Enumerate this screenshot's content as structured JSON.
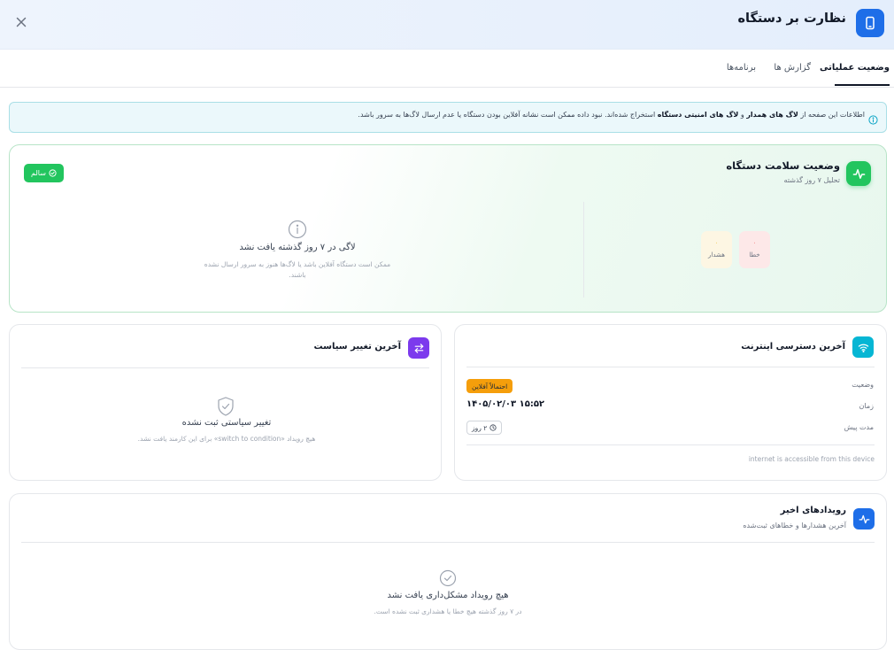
{
  "header": {
    "title": "نظارت بر دستگاه",
    "icon": "smartphone-icon",
    "close_icon": "close-icon"
  },
  "tabs": [
    {
      "label": "وضعیت عملیاتی",
      "active": true
    },
    {
      "label": "گزارش ها",
      "active": false
    },
    {
      "label": "برنامه‌ها",
      "active": false
    }
  ],
  "banner": {
    "part1": "اطلاعات این صفحه از ",
    "bold1": "لاگ های همدار",
    "part2": " و ",
    "bold2": "لاگ های امنیتی دستگاه",
    "part3": " استخراج شده‌اند. نبود داده ممکن است نشانه آفلاین بودن دستگاه یا عدم ارسال لاگ‌ها به سرور باشد.",
    "icon": "info-icon"
  },
  "health": {
    "title": "وضعیت سلامت دستگاه",
    "subtitle": "تحلیل ۷ روز گذشته",
    "status_badge": "سالم",
    "stats": {
      "error_value": "۰",
      "error_label": "خطا",
      "warning_value": "۰",
      "warning_label": "هشدار"
    },
    "empty_title": "لاگی در ۷ روز گذشته یافت نشد",
    "empty_subtitle": "ممکن است دستگاه آفلاین باشد یا لاگ‌ها هنوز به سرور ارسال نشده باشند.",
    "colors": {
      "accent": "#22c55e",
      "error_bg": "#fde8e8",
      "warning_bg": "#fdf6e3"
    }
  },
  "internet": {
    "title": "آخرین دسترسی اینترنت",
    "status_label": "وضعیت",
    "status_value": "احتمالاً آفلاین",
    "time_label": "زمان",
    "time_value": "۱۴۰۵/۰۲/۰۳ ۱۵:۵۲",
    "duration_label": "مدت پیش",
    "duration_value": "۲ روز",
    "footer": "internet is accessible from this device",
    "colors": {
      "icon_bg": "#06b6d4",
      "status_bg": "#f59e0b"
    }
  },
  "policy": {
    "title": "آخرین تغییر سیاست",
    "empty_title": "تغییر سیاستی ثبت نشده",
    "empty_subtitle": "هیچ رویداد «switch to condition» برای این کارمند یافت نشد.",
    "colors": {
      "icon_bg": "#7c3aed"
    }
  },
  "events": {
    "title": "رویدادهای اخیر",
    "subtitle": "آخرین هشدارها و خطاهای ثبت‌شده",
    "empty_title": "هیچ رویداد مشکل‌داری یافت نشد",
    "empty_subtitle": "در ۷ روز گذشته هیچ خطا یا هشداری ثبت نشده است.",
    "colors": {
      "icon_bg": "#1e6ee8"
    }
  }
}
